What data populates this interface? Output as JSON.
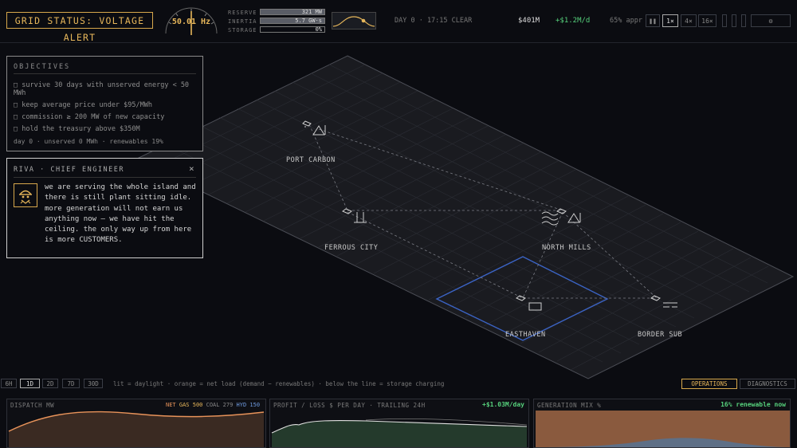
{
  "topbar": {
    "alert": "GRID STATUS: VOLTAGE ALERT",
    "frequency": "50.01 Hz",
    "reserve_label": "RESERVE",
    "reserve_value": "321 MW",
    "inertia_label": "INERTIA",
    "inertia_value": "5.7 GW·s",
    "storage_label": "STORAGE",
    "storage_value": "0%",
    "day_time": "DAY 0 · 17:15 CLEAR",
    "treasury": "$401M",
    "rate": "+$1.2M/d",
    "approval": "65% appr",
    "pause_label": "❚❚",
    "speed_1x": "1×",
    "speed_4x": "4×",
    "speed_16x": "16×",
    "settings_label": "⚙"
  },
  "objectives": {
    "title": "OBJECTIVES",
    "items": [
      "□ survive 30 days with unserved energy < 50 MWh",
      "□ keep average price under $95/MWh",
      "□ commission ≥ 200 MW of new capacity",
      "□ hold the treasury above $350M"
    ],
    "footer": "day 0 · unserved 0 MWh · renewables 19%"
  },
  "engineer": {
    "title": "RIVA · CHIEF ENGINEER",
    "close": "×",
    "message": "we are serving the whole island and there is still plant sitting idle. more generation will not earn us anything now — we have hit the ceiling. the only way up from here is more CUSTOMERS."
  },
  "map": {
    "cities": [
      "PORT CARBON",
      "FERROUS CITY",
      "NORTH MILLS",
      "EASTHAVEN",
      "BORDER SUB"
    ]
  },
  "bottom": {
    "ranges": [
      "6H",
      "1D",
      "2D",
      "7D",
      "30D"
    ],
    "selected_range": "1D",
    "legend": "lit = daylight · orange = net load (demand − renewables) · below the line = storage charging",
    "tabs": [
      "OPERATIONS",
      "DIAGNOSTICS"
    ],
    "dispatch": {
      "title": "DISPATCH MW",
      "net_label": "NET",
      "gas_label": "GAS 500",
      "coal_label": "COAL 279",
      "hyd_label": "HYD 150"
    },
    "profit": {
      "title": "PROFIT / LOSS $ PER DAY · TRAILING 24H",
      "value": "+$1.03M/day"
    },
    "genmix": {
      "title": "GENERATION MIX %",
      "value": "16% renewable now"
    }
  },
  "colors": {
    "accent": "#e6b65a",
    "positive": "#56d17c",
    "selection": "#3b63c4",
    "net_load": "#e8935a"
  }
}
